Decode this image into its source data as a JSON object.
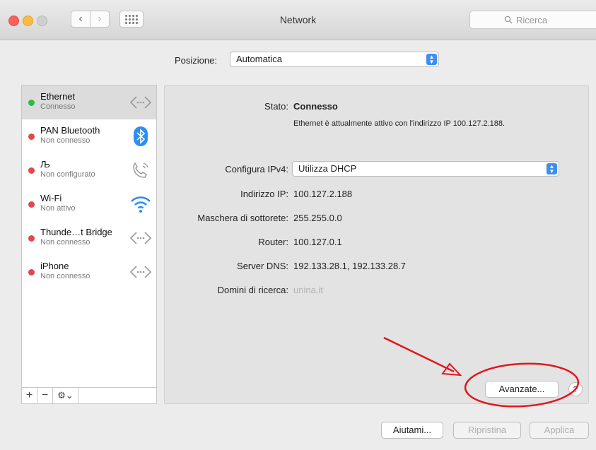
{
  "window": {
    "title": "Network",
    "search_placeholder": "Ricerca"
  },
  "location": {
    "label": "Posizione:",
    "value": "Automatica"
  },
  "services": [
    {
      "name": "Ethernet",
      "status": "Connesso",
      "status_color": "green",
      "icon": "ethernet-icon"
    },
    {
      "name": "PAN Bluetooth",
      "status": "Non connesso",
      "status_color": "red",
      "icon": "bluetooth-icon"
    },
    {
      "name": "Љ",
      "status": "Non configurato",
      "status_color": "red",
      "icon": "phone-icon"
    },
    {
      "name": "Wi-Fi",
      "status": "Non attivo",
      "status_color": "red",
      "icon": "wifi-icon"
    },
    {
      "name": "Thunde…t Bridge",
      "status": "Non connesso",
      "status_color": "red",
      "icon": "ethernet-icon"
    },
    {
      "name": "iPhone",
      "status": "Non connesso",
      "status_color": "red",
      "icon": "ethernet-icon"
    }
  ],
  "sidebar_controls": {
    "add": "+",
    "remove": "−",
    "gear": "⚙︎⌄"
  },
  "details": {
    "stato_label": "Stato:",
    "stato_value": "Connesso",
    "stato_desc": "Ethernet è attualmente attivo con l'indirizzo IP 100.127.2.188.",
    "ipv4_label": "Configura IPv4:",
    "ipv4_value": "Utilizza DHCP",
    "ip_label": "Indirizzo IP:",
    "ip_value": "100.127.2.188",
    "mask_label": "Maschera di sottorete:",
    "mask_value": "255.255.0.0",
    "router_label": "Router:",
    "router_value": "100.127.0.1",
    "dns_label": "Server DNS:",
    "dns_value": "192.133.28.1, 192.133.28.7",
    "domains_label": "Domini di ricerca:",
    "domains_value": "unina.it"
  },
  "buttons": {
    "advanced": "Avanzate...",
    "help": "?",
    "assist": "Aiutami...",
    "revert": "Ripristina",
    "apply": "Applica"
  },
  "colors": {
    "connected": "#2dbd3b",
    "disconnected": "#e8454b",
    "accent": "#3d8ef0",
    "annotation": "#e0161d"
  }
}
